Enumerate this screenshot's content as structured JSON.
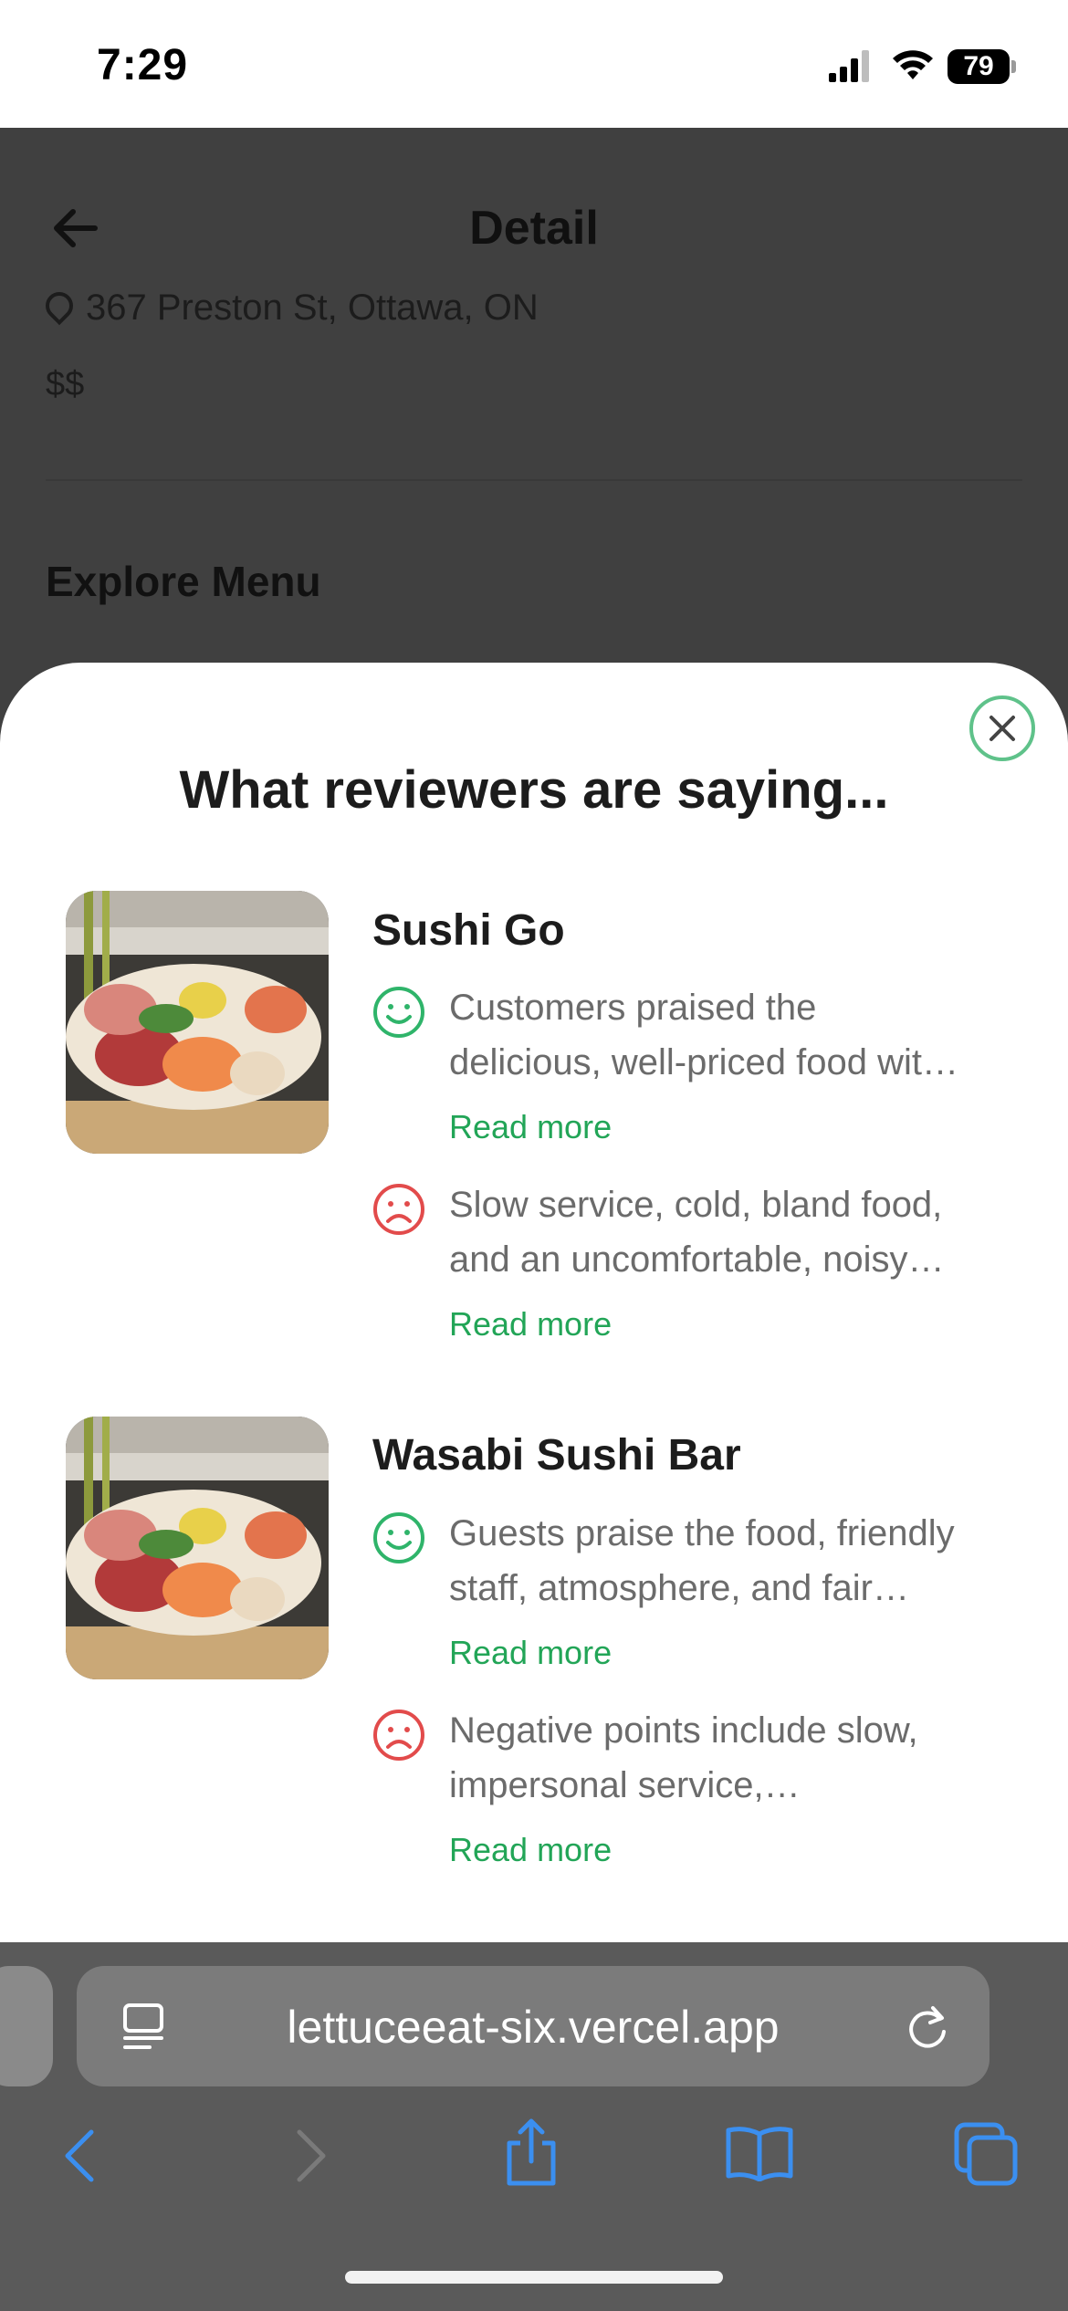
{
  "status_bar": {
    "time": "7:29",
    "battery": "79"
  },
  "background": {
    "title": "Detail",
    "address": "367 Preston St, Ottawa, ON",
    "price": "$$",
    "explore_heading": "Explore Menu"
  },
  "modal": {
    "title": "What reviewers are saying...",
    "restaurants": [
      {
        "name": "Sushi Go",
        "positive": [
          "Customers praised the",
          "delicious, well-priced food wit…"
        ],
        "negative": [
          "Slow service, cold, bland food,",
          "and an uncomfortable, noisy…"
        ],
        "read_more": "Read more"
      },
      {
        "name": "Wasabi Sushi Bar",
        "positive": [
          "Guests praise the food, friendly",
          "staff, atmosphere, and fair…"
        ],
        "negative": [
          "Negative points include slow,",
          "impersonal service,…"
        ],
        "read_more": "Read more"
      }
    ]
  },
  "browser": {
    "url": "lettuceeat-six.vercel.app"
  },
  "colors": {
    "positive": "#2fb46a",
    "negative": "#e24b4b",
    "link": "#22a557",
    "close_ring": "#5fc28a",
    "safari_blue": "#3b8ff0"
  },
  "icons": [
    "signal-icon",
    "wifi-icon",
    "battery-icon",
    "back-arrow-icon",
    "location-pin-icon",
    "close-icon",
    "smile-icon",
    "frown-icon",
    "page-menu-icon",
    "reload-icon",
    "browser-back-icon",
    "browser-forward-icon",
    "share-icon",
    "bookmarks-icon",
    "tabs-icon"
  ]
}
